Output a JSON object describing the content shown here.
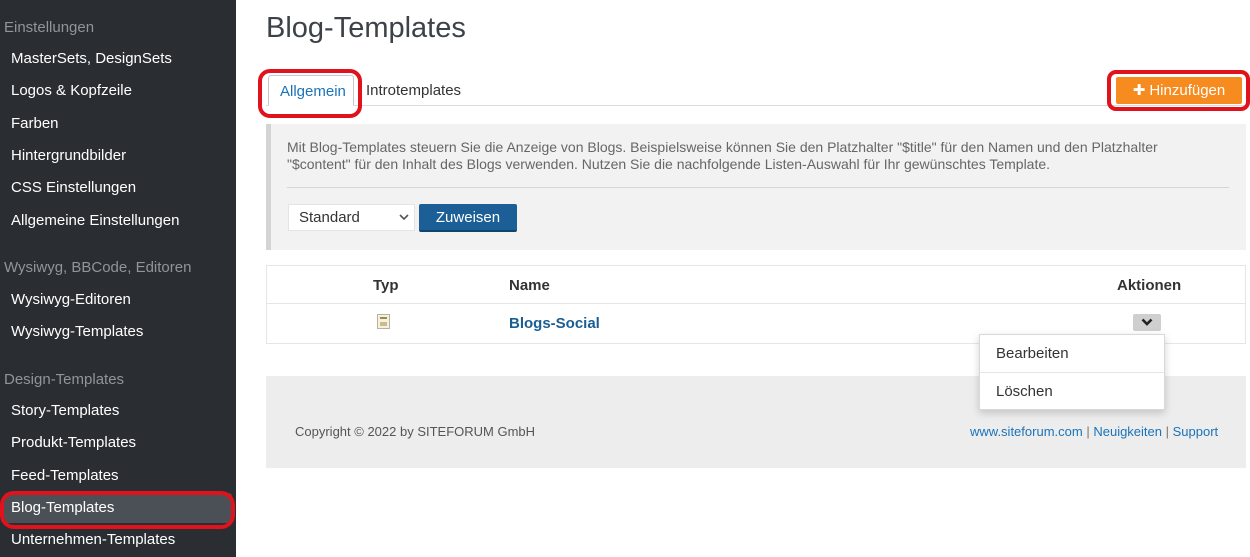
{
  "sidebar": {
    "sections": [
      {
        "title": "Einstellungen"
      },
      {
        "title": "Wysiwyg, BBCode, Editoren"
      },
      {
        "title": "Design-Templates"
      }
    ],
    "items": [
      {
        "label": "MasterSets, DesignSets"
      },
      {
        "label": "Logos & Kopfzeile"
      },
      {
        "label": "Farben"
      },
      {
        "label": "Hintergrundbilder"
      },
      {
        "label": "CSS Einstellungen"
      },
      {
        "label": "Allgemeine Einstellungen"
      },
      {
        "label": "Wysiwyg-Editoren"
      },
      {
        "label": "Wysiwyg-Templates"
      },
      {
        "label": "Story-Templates"
      },
      {
        "label": "Produkt-Templates"
      },
      {
        "label": "Feed-Templates"
      },
      {
        "label": "Blog-Templates",
        "active": true
      },
      {
        "label": "Unternehmen-Templates"
      }
    ]
  },
  "main": {
    "title": "Blog-Templates",
    "tabs": [
      {
        "label": "Allgemein",
        "active": true
      },
      {
        "label": "Introtemplates"
      }
    ],
    "add_button": "Hinzufügen",
    "info_text": "Mit Blog-Templates steuern Sie die Anzeige von Blogs. Beispielsweise können Sie den Platzhalter \"$title\" für den Namen und den Platzhalter \"$content\" für den Inhalt des Blogs verwenden. Nutzen Sie die nachfolgende Listen-Auswahl für Ihr gewünschtes Template.",
    "select_value": "Standard",
    "assign_button": "Zuweisen",
    "table": {
      "headers": [
        "Typ",
        "Name",
        "Aktionen"
      ],
      "rows": [
        {
          "type_icon": "template-icon",
          "name": "Blogs-Social"
        }
      ]
    },
    "dropdown": [
      "Bearbeiten",
      "Löschen"
    ],
    "footer": {
      "copyright": "Copyright © 2022 by SITEFORUM GmbH",
      "links": [
        "www.siteforum.com",
        "Neuigkeiten",
        "Support"
      ],
      "separator": "|"
    }
  },
  "colors": {
    "sidebar_bg": "#2a2e33",
    "accent_orange": "#f68b1f",
    "primary_blue": "#1b5f96",
    "link_blue": "#1a73b8",
    "annotation_red": "#e0121b"
  }
}
